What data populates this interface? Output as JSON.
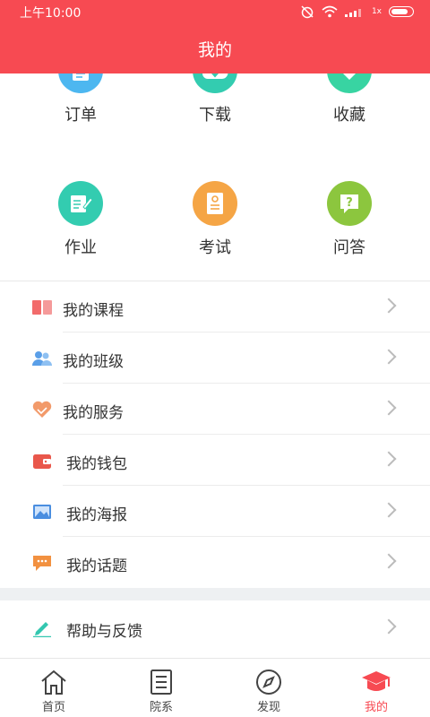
{
  "status_bar": {
    "time": "上午10:00",
    "signal_text": "1x"
  },
  "header": {
    "title": "我的"
  },
  "grid": [
    {
      "label": "订单",
      "icon": "clipboard-icon",
      "color": "#4db7f0"
    },
    {
      "label": "下载",
      "icon": "cloud-download-icon",
      "color": "#33ccb0"
    },
    {
      "label": "收藏",
      "icon": "heart-icon",
      "color": "#38d4a2"
    },
    {
      "label": "作业",
      "icon": "notepad-edit-icon",
      "color": "#33ccb0"
    },
    {
      "label": "考试",
      "icon": "exam-paper-icon",
      "color": "#f5a545"
    },
    {
      "label": "问答",
      "icon": "question-chat-icon",
      "color": "#8cc63e"
    }
  ],
  "menu": [
    {
      "label": "我的课程",
      "icon": "book-icon",
      "color": "#f26b6b"
    },
    {
      "label": "我的班级",
      "icon": "people-icon",
      "color": "#5a9fe8"
    },
    {
      "label": "我的服务",
      "icon": "handshake-heart-icon",
      "color": "#f29a6a"
    },
    {
      "label": "我的钱包",
      "icon": "wallet-icon",
      "color": "#e9574b"
    },
    {
      "label": "我的海报",
      "icon": "picture-icon",
      "color": "#4a8ee0"
    },
    {
      "label": "我的话题",
      "icon": "chat-bubble-icon",
      "color": "#f29140"
    }
  ],
  "help": {
    "label": "帮助与反馈",
    "icon": "pencil-icon",
    "color": "#33c7b0"
  },
  "tabs": [
    {
      "label": "首页",
      "icon": "home-icon"
    },
    {
      "label": "院系",
      "icon": "list-document-icon"
    },
    {
      "label": "发现",
      "icon": "compass-icon"
    },
    {
      "label": "我的",
      "icon": "graduation-cap-icon",
      "active": true
    }
  ],
  "colors": {
    "brand": "#f74a52",
    "divider": "#ececec",
    "section_gap": "#eef0f2"
  }
}
